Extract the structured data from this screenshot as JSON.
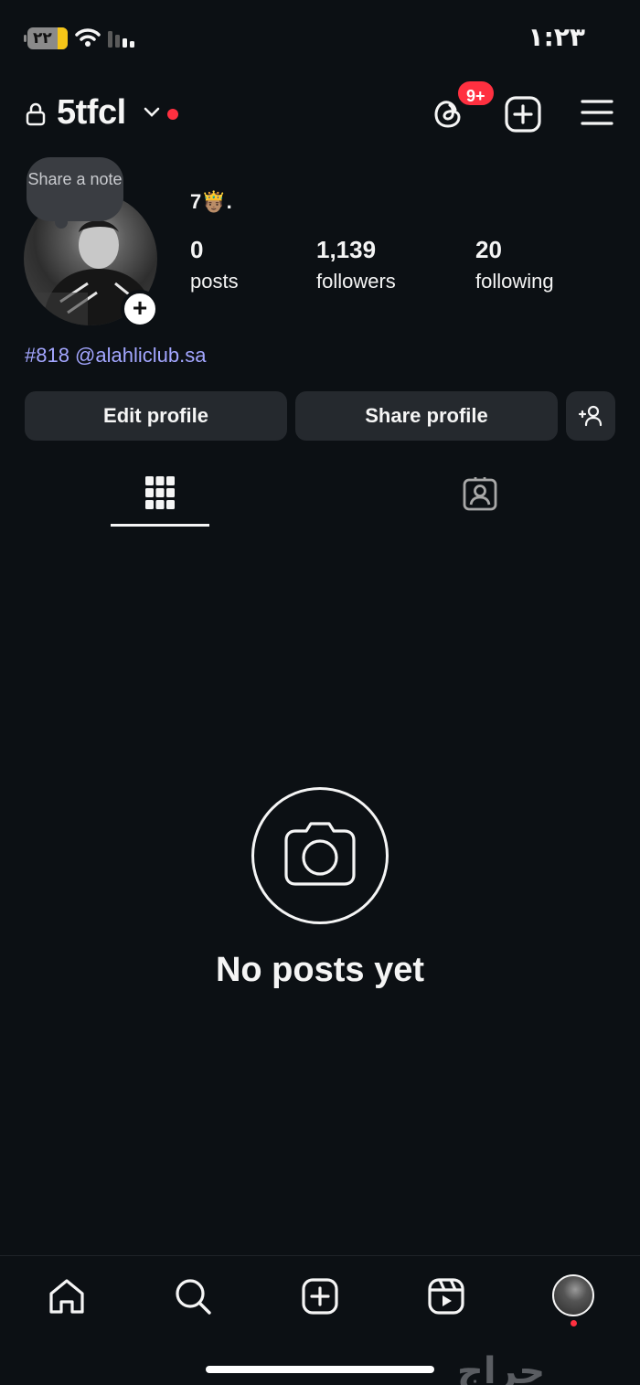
{
  "status_bar": {
    "time": "١:٢٣",
    "battery": "٢٢"
  },
  "header": {
    "username": "5tfcl",
    "notification_badge": "9+"
  },
  "profile": {
    "note": "Share a note",
    "display_name": "7🤴🏽.",
    "stats": {
      "posts_count": "0",
      "posts_label": "posts",
      "followers_count": "1,139",
      "followers_label": "followers",
      "following_count": "20",
      "following_label": "following"
    },
    "bio": "#818 @alahliclub.sa"
  },
  "actions": {
    "edit_profile": "Edit profile",
    "share_profile": "Share profile"
  },
  "empty_state": {
    "message": "No posts yet"
  },
  "watermark": "حراج",
  "colors": {
    "background": "#0c1014",
    "button": "#25292e",
    "accent_red": "#ff3040",
    "link": "#a3a6ff"
  },
  "icons": {
    "header": [
      "lock-icon",
      "chevron-down-icon",
      "threads-icon",
      "plus-square-icon",
      "menu-icon"
    ],
    "tabs": [
      "grid-icon",
      "tagged-icon"
    ],
    "bottom_nav": [
      "home-icon",
      "search-icon",
      "create-icon",
      "reels-icon",
      "profile-avatar"
    ]
  }
}
